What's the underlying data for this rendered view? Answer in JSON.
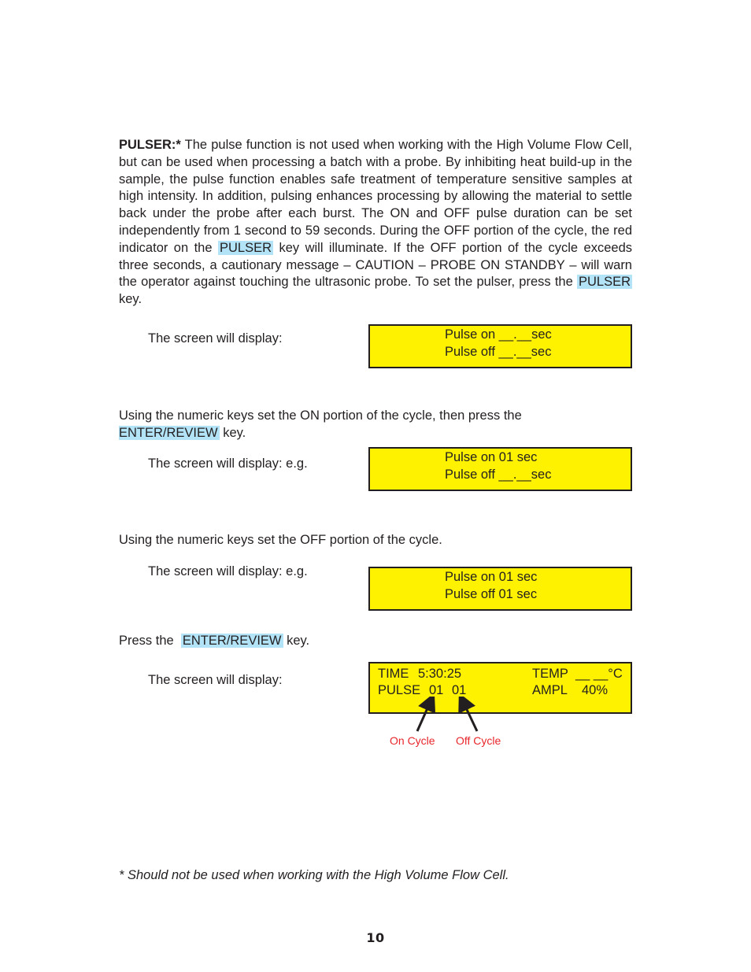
{
  "intro": {
    "heading": "PULSER:*",
    "text_1": " The pulse function is not used when working with the High Volume Flow Cell, but can be used when processing a batch with a probe. By inhibiting heat build-up in the sample, the pulse function enables safe treatment of temperature sensitive samples at high intensity. In addition, pulsing enhances processing by allowing the material to settle back under the probe after each burst. The ON and OFF pulse duration can be set independently from 1 second to 59 seconds. During the OFF portion of the cycle, the red indicator on the ",
    "key_1": "PULSER",
    "text_2": " key will illuminate. If the OFF portion of the cycle exceeds three seconds, a cautionary message – CAUTION – PROBE ON STANDBY – will warn the operator against touching the ultrasonic probe. To set the pulser, press the ",
    "key_2": "PULSER",
    "text_3": " key."
  },
  "steps": [
    {
      "screen_label": "The screen will display:",
      "display": [
        "Pulse on __.__sec",
        "Pulse off __.__sec"
      ]
    },
    {
      "instruction": "Using the numeric keys set the ON portion of the cycle, then press the",
      "key": "ENTER/REVIEW",
      "instruction_end": " key.",
      "screen_label": "The screen will display:  e.g.",
      "display": [
        "Pulse on 01 sec",
        "Pulse off __.__sec"
      ]
    },
    {
      "instruction": "Using the numeric keys set the OFF portion of the cycle.",
      "screen_label": "The screen will display:  e.g.",
      "display": [
        "Pulse on 01 sec",
        "Pulse off 01 sec"
      ]
    },
    {
      "instruction": "Press the ",
      "key": "ENTER/REVIEW",
      "instruction_end": " key.",
      "screen_label": "The screen will display:",
      "display": {
        "time_label": "TIME",
        "time_value": "5:30:25",
        "temp_label": "TEMP",
        "temp_value": "__ __°C",
        "pulse_label": "PULSE",
        "pulse_on": "01",
        "pulse_off": "01",
        "ampl_label": "AMPL",
        "ampl_value": "40%"
      },
      "annotations": {
        "on_cycle": "On Cycle",
        "off_cycle": "Off Cycle"
      }
    }
  ],
  "footnote": "* Should not be used when working with the High Volume Flow Cell.",
  "page_number": "10",
  "colors": {
    "lcd_yellow": "#fff200",
    "key_highlight": "#b3e3f7",
    "annotation_red": "#e8262b"
  }
}
